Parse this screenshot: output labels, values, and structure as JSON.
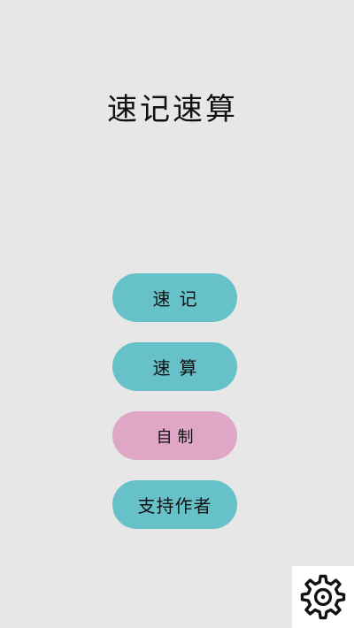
{
  "app": {
    "title": "速记速算"
  },
  "menu": {
    "buttons": [
      {
        "label": "速记",
        "color": "#66c2c8"
      },
      {
        "label": "速算",
        "color": "#66c2c8"
      },
      {
        "label": "自制",
        "color": "#dfa6c6"
      },
      {
        "label": "支持作者",
        "color": "#66c2c8"
      }
    ]
  },
  "settings": {
    "icon": "gear-icon"
  },
  "colors": {
    "background": "#e7e7e7",
    "accent_teal": "#66c2c8",
    "accent_pink": "#dfa6c6"
  }
}
